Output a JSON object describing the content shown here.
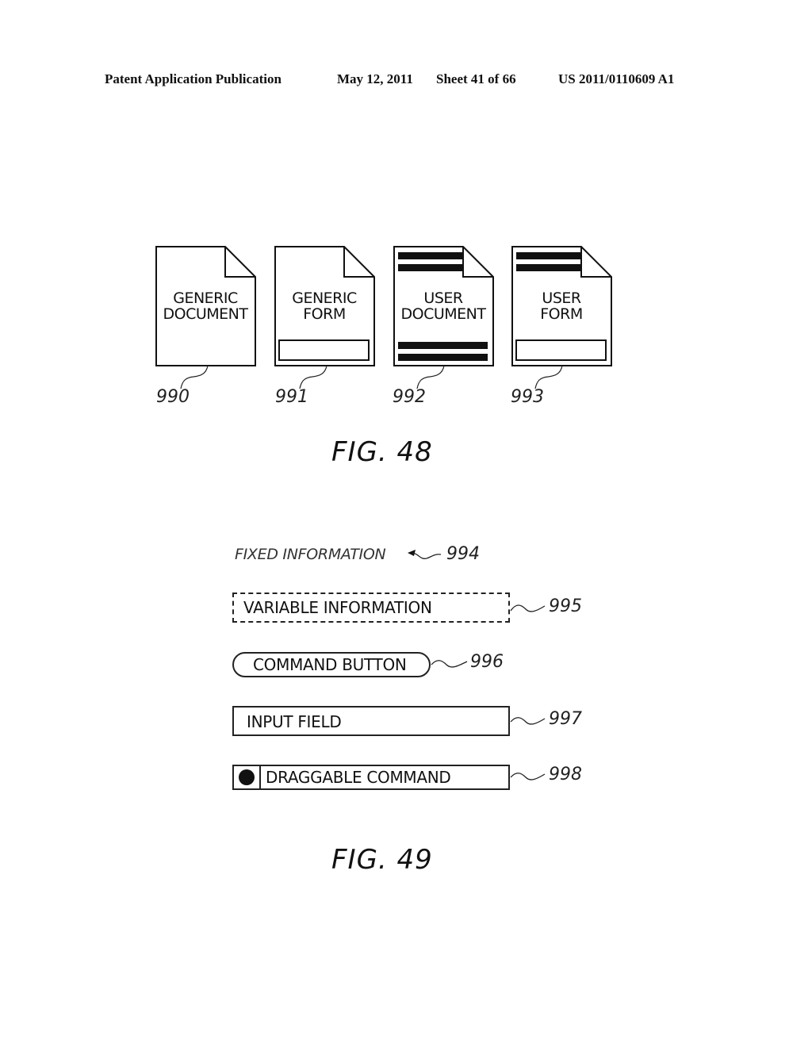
{
  "header": {
    "publication": "Patent Application Publication",
    "date": "May 12, 2011",
    "sheet": "Sheet 41 of 66",
    "number": "US 2011/0110609 A1"
  },
  "fig48": {
    "caption": "FIG. 48",
    "documents": [
      {
        "line1": "GENERIC",
        "line2": "DOCUMENT",
        "ref": "990",
        "type": "generic-document"
      },
      {
        "line1": "GENERIC",
        "line2": "FORM",
        "ref": "991",
        "type": "generic-form"
      },
      {
        "line1": "USER",
        "line2": "DOCUMENT",
        "ref": "992",
        "type": "user-document"
      },
      {
        "line1": "USER",
        "line2": "FORM",
        "ref": "993",
        "type": "user-form"
      }
    ]
  },
  "fig49": {
    "caption": "FIG. 49",
    "items": [
      {
        "label": "FIXED INFORMATION",
        "ref": "994"
      },
      {
        "label": "VARIABLE INFORMATION",
        "ref": "995"
      },
      {
        "label": "COMMAND BUTTON",
        "ref": "996"
      },
      {
        "label": "INPUT FIELD",
        "ref": "997"
      },
      {
        "label": "DRAGGABLE COMMAND",
        "ref": "998"
      }
    ]
  }
}
